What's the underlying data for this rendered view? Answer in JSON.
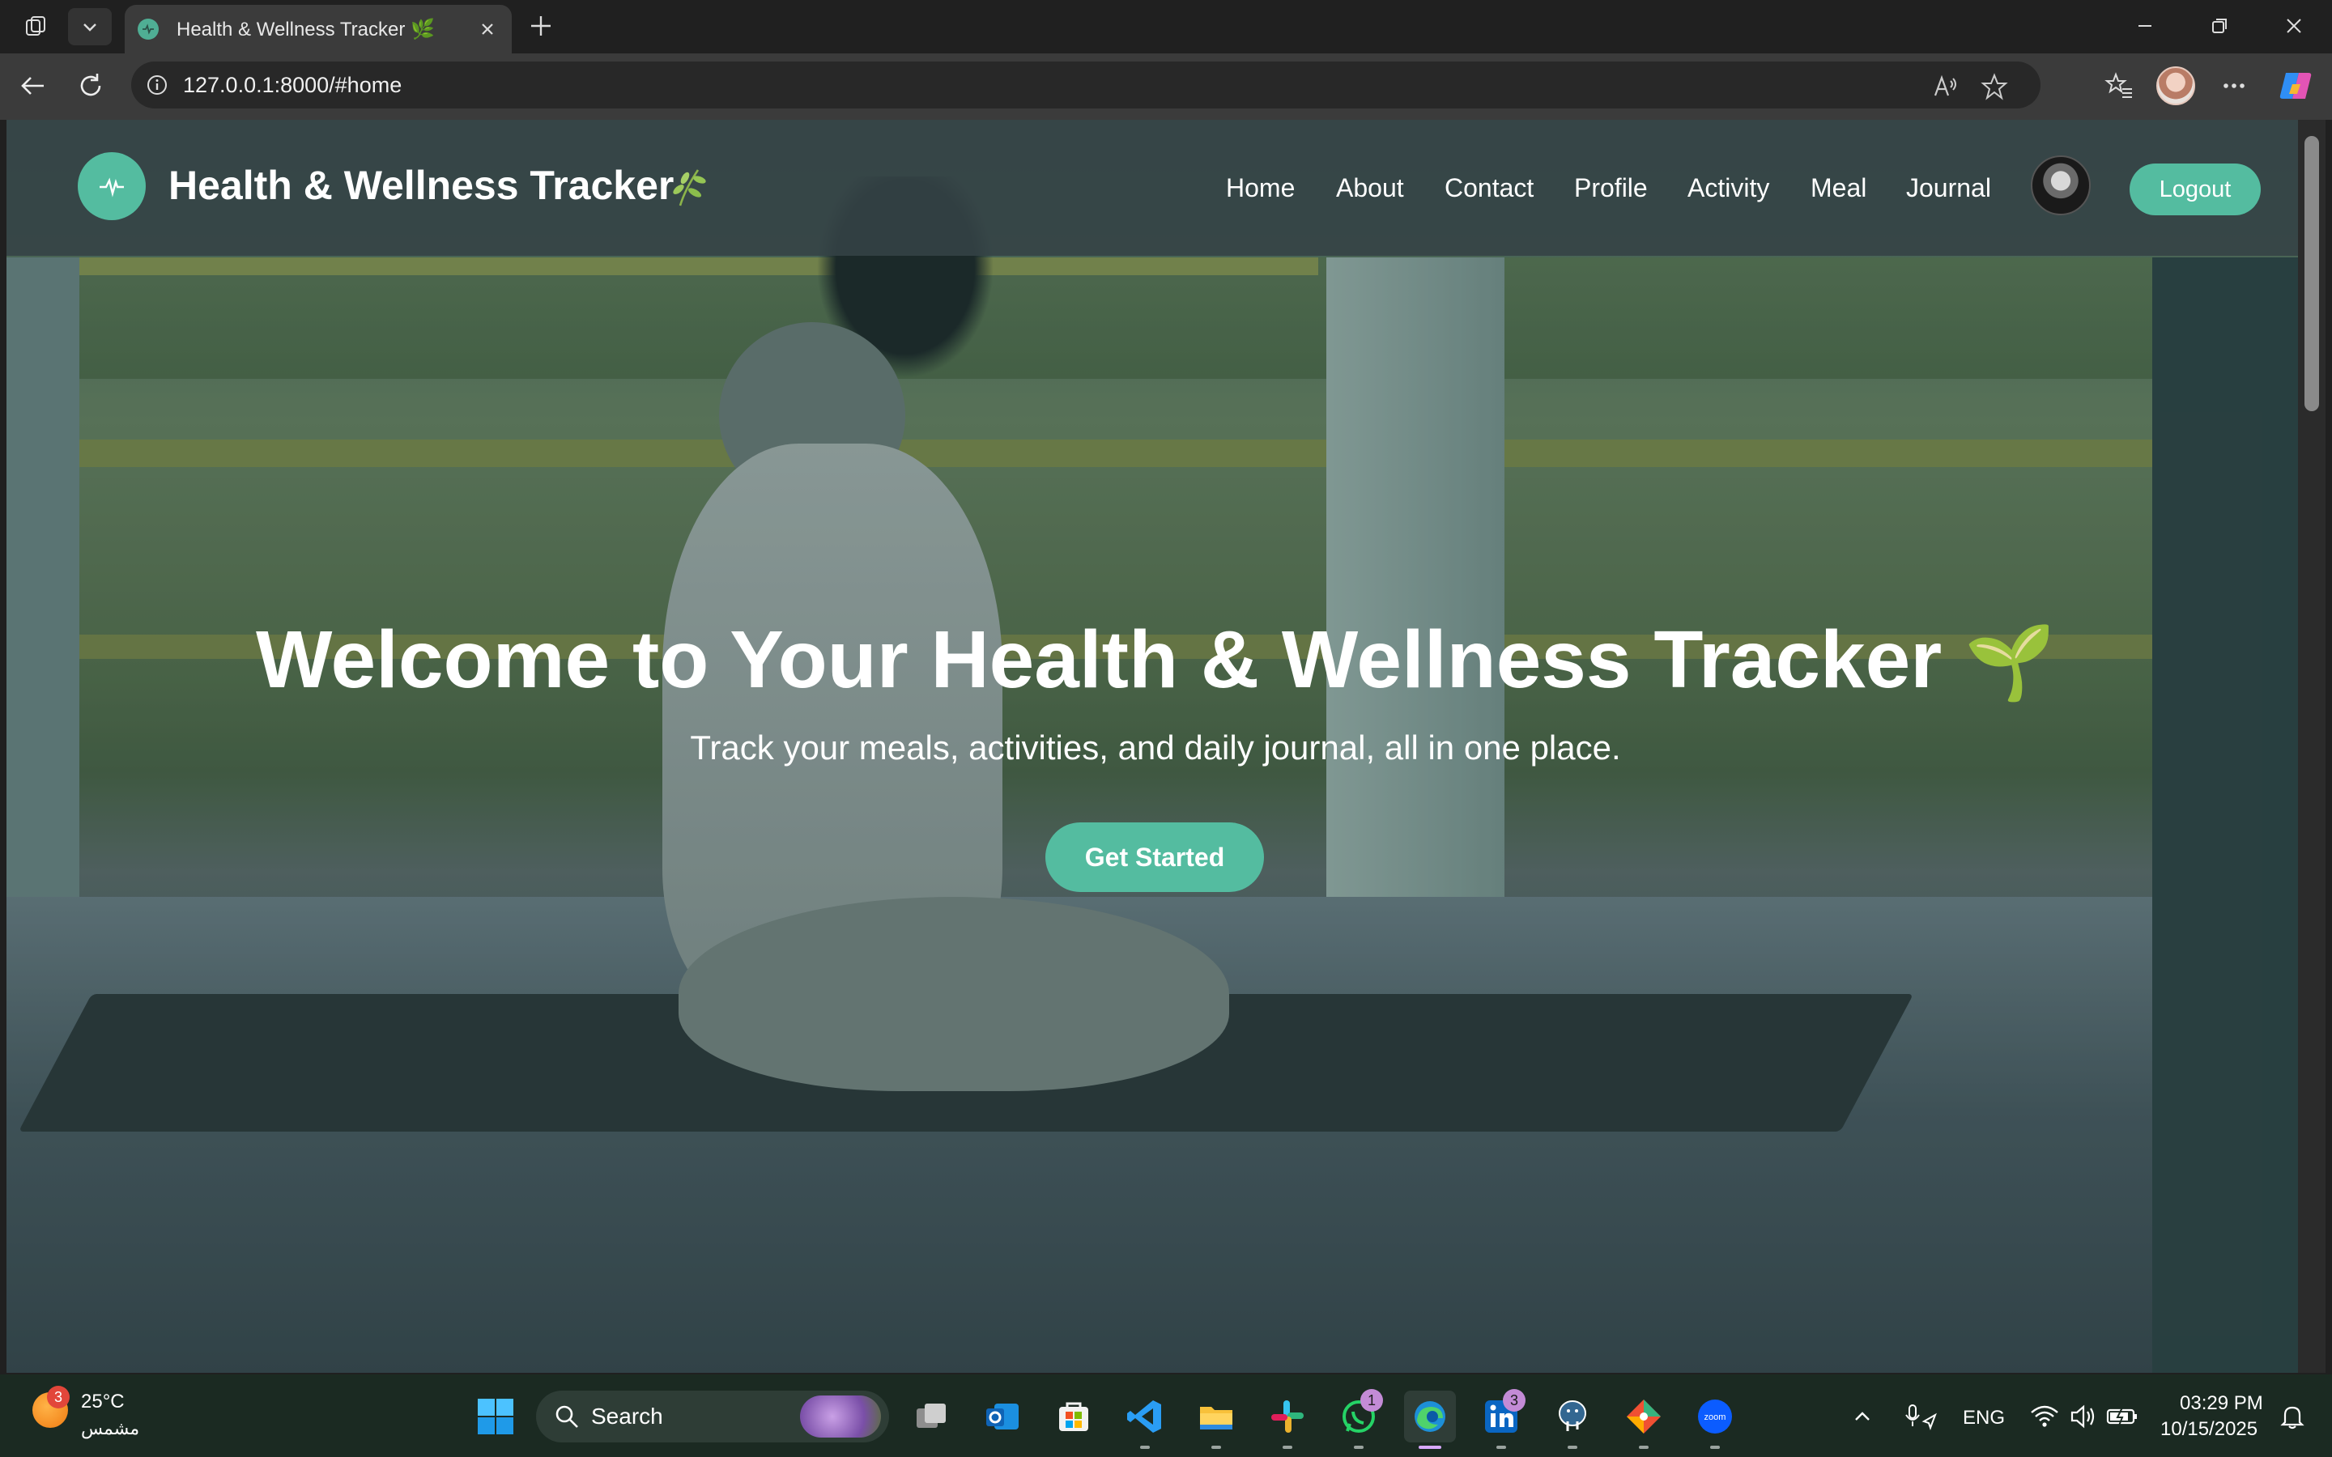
{
  "browser": {
    "tab_title": "Health & Wellness Tracker 🌿",
    "url": "127.0.0.1:8000/#home"
  },
  "header": {
    "brand": "Health & Wellness Tracker",
    "nav": [
      "Home",
      "About",
      "Contact",
      "Profile",
      "Activity",
      "Meal",
      "Journal"
    ],
    "logout_label": "Logout"
  },
  "hero": {
    "title": "Welcome to Your Health & Wellness Tracker",
    "title_emoji": "🌱",
    "subtitle": "Track your meals, activities, and daily journal, all in one place.",
    "cta_label": "Get Started"
  },
  "taskbar": {
    "weather_temp": "25°C",
    "weather_desc": "مشمس",
    "weather_badge": "3",
    "search_label": "Search",
    "whatsapp_badge": "1",
    "linkedin_badge": "3",
    "language": "ENG",
    "time": "03:29 PM",
    "date": "10/15/2025"
  },
  "colors": {
    "accent": "#54bca0",
    "header_bg": "#344246",
    "chrome_bg": "#202020",
    "taskbar_bg": "#1b2a22"
  },
  "icons": {
    "workspaces": "workspaces-icon",
    "tab_list": "chevron-down-icon",
    "back": "back-arrow-icon",
    "refresh": "refresh-icon",
    "info": "info-icon",
    "read_aloud": "read-aloud-icon",
    "favorite": "star-icon",
    "favorites": "favorites-icon",
    "more": "more-icon",
    "copilot": "copilot-icon"
  }
}
